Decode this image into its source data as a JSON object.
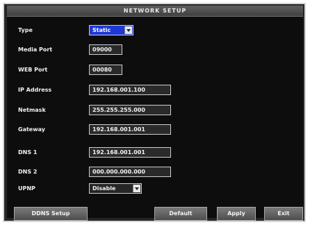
{
  "window": {
    "title": "NETWORK SETUP"
  },
  "fields": {
    "type": {
      "label": "Type",
      "value": "Static"
    },
    "media_port": {
      "label": "Media Port",
      "value": "09000"
    },
    "web_port": {
      "label": "WEB Port",
      "value": "00080"
    },
    "ip_address": {
      "label": "IP Address",
      "value": "192.168.001.100"
    },
    "netmask": {
      "label": "Netmask",
      "value": "255.255.255.000"
    },
    "gateway": {
      "label": "Gateway",
      "value": "192.168.001.001"
    },
    "dns1": {
      "label": "DNS 1",
      "value": "192.168.001.001"
    },
    "dns2": {
      "label": "DNS 2",
      "value": "000.000.000.000"
    },
    "upnp": {
      "label": "UPNP",
      "value": "Disable"
    }
  },
  "buttons": {
    "ddns_setup": "DDNS Setup",
    "default": "Default",
    "apply": "Apply",
    "exit": "Exit"
  },
  "colors": {
    "selected_field": "#1e39d6",
    "panel_background": "#0d0d0d",
    "button_gradient_top": "#7a7a7a"
  }
}
